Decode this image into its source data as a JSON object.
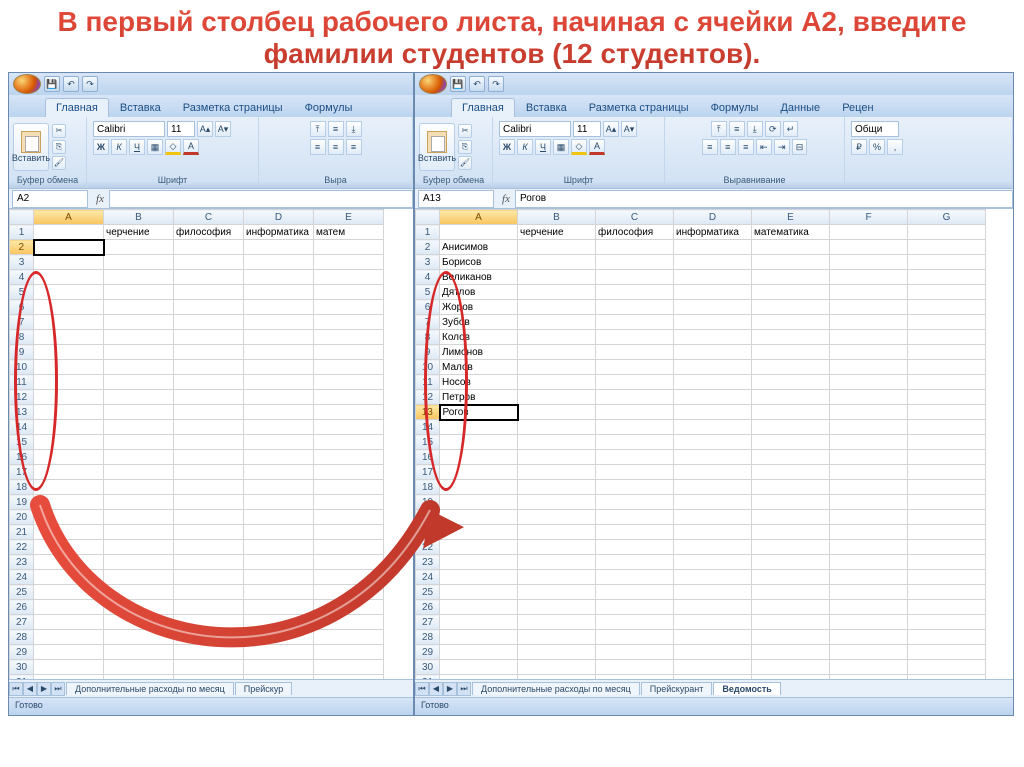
{
  "title": "В первый столбец рабочего листа, начиная с ячейки А2, введите фамилии студентов (12 студентов).",
  "ribbon": {
    "tabs": [
      "Главная",
      "Вставка",
      "Разметка страницы",
      "Формулы",
      "Данные",
      "Рецен"
    ],
    "paste": "Вставить",
    "clipboard": "Буфер обмена",
    "font": "Шрифт",
    "alignment": "Выравнивание",
    "font_name": "Calibri",
    "font_size": "11",
    "number_format": "Общи"
  },
  "left": {
    "name_box": "A2",
    "formula": "",
    "columns": [
      "A",
      "B",
      "C",
      "D",
      "E"
    ],
    "headers_row1": [
      "",
      "черчение",
      "философия",
      "информатика",
      "матем"
    ],
    "selected_cell": {
      "row": 2,
      "col": 0
    },
    "sheets": [
      "Дополнительные расходы по месяц",
      "Прейскур"
    ],
    "status": "Готово"
  },
  "right": {
    "name_box": "A13",
    "formula": "Рогов",
    "columns": [
      "A",
      "B",
      "C",
      "D",
      "E",
      "F",
      "G"
    ],
    "headers_row1": [
      "",
      "черчение",
      "философия",
      "информатика",
      "математика",
      "",
      ""
    ],
    "students": [
      "Анисимов",
      "Борисов",
      "Великанов",
      "Дятлов",
      "Жоров",
      "Зубов",
      "Колов",
      "Лимонов",
      "Малов",
      "Носов",
      "Петров",
      "Рогов"
    ],
    "selected_cell": {
      "row": 13,
      "col": 0
    },
    "sheets": [
      "Дополнительные расходы по месяц",
      "Прейскурант",
      "Ведомость"
    ],
    "active_sheet": 2,
    "status": "Готово"
  }
}
